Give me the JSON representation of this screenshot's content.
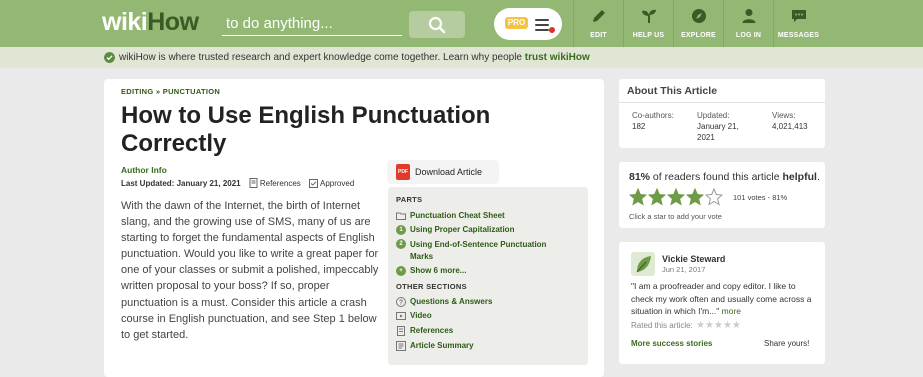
{
  "header": {
    "logo_wiki": "wiki",
    "logo_how": "How",
    "search_placeholder": "to do anything...",
    "pro_label": "PRO",
    "nav": [
      {
        "label": "EDIT",
        "icon": "pencil-icon"
      },
      {
        "label": "HELP US",
        "icon": "sprout-icon"
      },
      {
        "label": "EXPLORE",
        "icon": "compass-icon"
      },
      {
        "label": "LOG IN",
        "icon": "user-icon"
      },
      {
        "label": "MESSAGES",
        "icon": "chat-icon"
      }
    ]
  },
  "infobar": {
    "text": "wikiHow is where trusted research and expert knowledge come together. Learn why people ",
    "link": "trust wikiHow"
  },
  "article": {
    "breadcrumb": [
      "EDITING",
      "PUNCTUATION"
    ],
    "title": "How to Use English Punctuation Correctly",
    "author_info": "Author Info",
    "last_updated_label": "Last Updated:",
    "last_updated": "January 21, 2021",
    "references": "References",
    "approved": "Approved",
    "intro": "With the dawn of the Internet, the birth of Internet slang, and the growing use of SMS, many of us are starting to forget the fundamental aspects of English punctuation. Would you like to write a great paper for one of your classes or submit a polished, impeccably written proposal to your boss? If so, proper punctuation is a must. Consider this article a crash course in English punctuation, and see Step 1 below to get started.",
    "download_label": "Download Article",
    "pdf_label": "PDF"
  },
  "toc": {
    "parts_heading": "PARTS",
    "parts": [
      {
        "num": "",
        "label": "Punctuation Cheat Sheet"
      },
      {
        "num": "1",
        "label": "Using Proper Capitalization"
      },
      {
        "num": "2",
        "label": "Using End-of-Sentence Punctuation Marks"
      }
    ],
    "show_more": "Show 6 more...",
    "other_heading": "OTHER SECTIONS",
    "other": [
      "Questions & Answers",
      "Video",
      "References",
      "Article Summary"
    ]
  },
  "about": {
    "heading": "About This Article",
    "coauthors_label": "Co-authors:",
    "coauthors": "182",
    "updated_label": "Updated:",
    "updated": "January 21, 2021",
    "views_label": "Views:",
    "views": "4,021,413"
  },
  "helpful": {
    "percent": "81%",
    "text_pre": " of readers found this article ",
    "text_bold": "helpful",
    "text_post": ".",
    "rating_stars": 4,
    "votes": "101 votes - 81%",
    "hint": "Click a star to add your vote"
  },
  "review": {
    "name": "Vickie Steward",
    "date": "Jun 21, 2017",
    "quote": "\"I am a proofreader and copy editor. I like to check my work often and usually come across a situation in which I'm...\"",
    "more": "more",
    "rated_label": "Rated this article:",
    "more_stories": "More success stories",
    "share": "Share yours!"
  },
  "colors": {
    "header_green": "#93b874",
    "link_green": "#3b6b1e",
    "star_green": "#6e9b48"
  }
}
